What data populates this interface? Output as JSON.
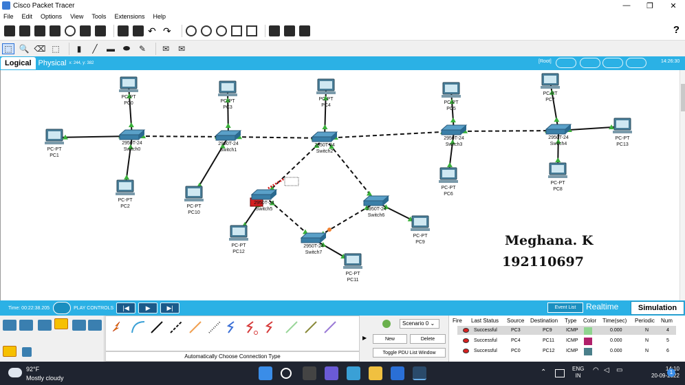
{
  "window": {
    "title": "Cisco Packet Tracer",
    "buttons": [
      "—",
      "❐",
      "✕"
    ]
  },
  "menu": [
    "File",
    "Edit",
    "Options",
    "View",
    "Tools",
    "Extensions",
    "Help"
  ],
  "help": "?",
  "tabs": {
    "logical": "Logical",
    "physical": "Physical",
    "coords": "x: 244, y: 382",
    "root": "[Root]",
    "clock": "14:26:30"
  },
  "devices": [
    {
      "name": "PC-PT",
      "label": "PC0"
    },
    {
      "name": "PC-PT",
      "label": "PC1"
    },
    {
      "name": "PC-PT",
      "label": "PC2"
    },
    {
      "name": "PC-PT",
      "label": "PC3"
    },
    {
      "name": "PC-PT",
      "label": "PC4"
    },
    {
      "name": "PC-PT",
      "label": "PC5"
    },
    {
      "name": "PC-PT",
      "label": "PC6"
    },
    {
      "name": "PC-PT",
      "label": "PC7"
    },
    {
      "name": "PC-PT",
      "label": "PC8"
    },
    {
      "name": "PC-PT",
      "label": "PC9"
    },
    {
      "name": "PC-PT",
      "label": "PC10"
    },
    {
      "name": "PC-PT",
      "label": "PC11"
    },
    {
      "name": "PC-PT",
      "label": "PC12"
    },
    {
      "name": "PC-PT",
      "label": "PC13"
    },
    {
      "name": "2950T-24",
      "label": "Switch0"
    },
    {
      "name": "2950T-24",
      "label": "Switch1"
    },
    {
      "name": "2950T-24",
      "label": "Switch2"
    },
    {
      "name": "2950T-24",
      "label": "Switch3"
    },
    {
      "name": "2950T-24",
      "label": "Switch4"
    },
    {
      "name": "2950T-24",
      "label": "Switch5"
    },
    {
      "name": "2950T-24",
      "label": "Switch6"
    },
    {
      "name": "2950T-24",
      "label": "Switch7"
    }
  ],
  "signature": {
    "name": "Meghana. K",
    "id": "192110697"
  },
  "sim": {
    "time": "Time: 00:22:38.205",
    "play_controls": "PLAY CONTROLS",
    "event_list": "Event List",
    "realtime": "Realtime",
    "simulation": "Simulation"
  },
  "connection_caption": "Automatically Choose Connection Type",
  "pdu": {
    "scenario": "Scenario 0",
    "new": "New",
    "delete": "Delete",
    "toggle": "Toggle PDU List Window"
  },
  "pdu_table": {
    "headers": [
      "Fire",
      "Last Status",
      "Source",
      "Destination",
      "Type",
      "Color",
      "Time(sec)",
      "Periodic",
      "Num"
    ],
    "rows": [
      {
        "status": "Successful",
        "source": "PC3",
        "dest": "PC9",
        "type": "ICMP",
        "color": "#8fd48f",
        "time": "0.000",
        "periodic": "N",
        "num": "4"
      },
      {
        "status": "Successful",
        "source": "PC4",
        "dest": "PC11",
        "type": "ICMP",
        "color": "#b0206a",
        "time": "0.000",
        "periodic": "N",
        "num": "5"
      },
      {
        "status": "Successful",
        "source": "PC0",
        "dest": "PC12",
        "type": "ICMP",
        "color": "#4a7f8a",
        "time": "0.000",
        "periodic": "N",
        "num": "6"
      }
    ]
  },
  "taskbar": {
    "temp": "92°F",
    "weather": "Mostly cloudy",
    "lang1": "ENG",
    "lang2": "IN",
    "time": "14:10",
    "date": "20-09-2022",
    "badge": "1"
  }
}
